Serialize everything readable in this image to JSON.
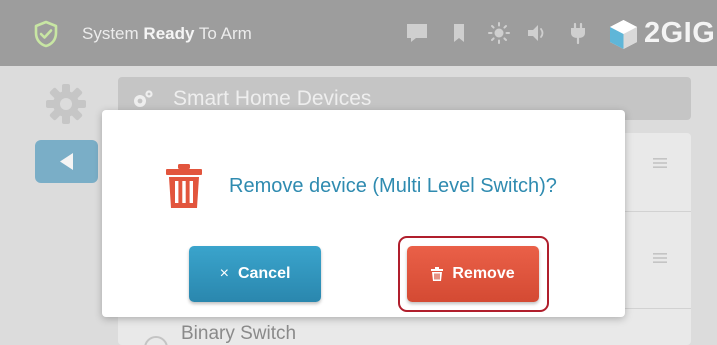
{
  "status_bar": {
    "status_prefix": "System",
    "status_bold": "Ready",
    "status_suffix": "To Arm",
    "brand": "2GIG",
    "icons": [
      "shield-check-icon",
      "message-icon",
      "bookmark-icon",
      "brightness-icon",
      "volume-icon",
      "power-plug-icon",
      "brand-cube-icon"
    ]
  },
  "background_screen": {
    "section_title": "Smart Home Devices",
    "device_rows": [
      {
        "label": ""
      },
      {
        "label": ""
      },
      {
        "label": "Binary Switch"
      }
    ]
  },
  "dialog": {
    "message": "Remove device (Multi Level Switch)?",
    "cancel_label": "Cancel",
    "cancel_glyph": "×",
    "remove_label": "Remove"
  },
  "colors": {
    "topbar": "#9d9d9d",
    "message_text": "#2f8bb0",
    "trash_icon": "#e2553d",
    "cancel_button": "#2f95bd",
    "remove_button": "#df5640",
    "highlight_outline": "#b01e2c"
  }
}
